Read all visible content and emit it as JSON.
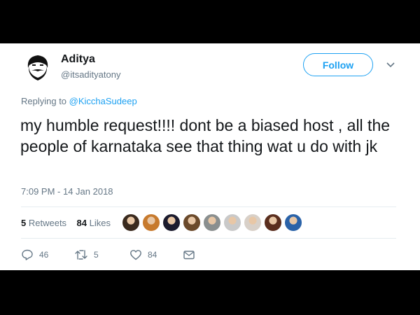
{
  "user": {
    "name": "Aditya",
    "handle": "@itsadityatony",
    "avatar_icon": "mustache-face-icon"
  },
  "follow_label": "Follow",
  "reply": {
    "prefix": "Replying to ",
    "mention": "@KicchaSudeep"
  },
  "tweet_text": "my humble request!!!! dont be a biased host , all the people of karnataka see that thing wat u do with jk",
  "timestamp": "7:09 PM - 14 Jan 2018",
  "stats": {
    "retweets_count": "5",
    "retweets_label": "Retweets",
    "likes_count": "84",
    "likes_label": "Likes"
  },
  "liker_avatars": [
    "#3a2a1e",
    "#c77a2d",
    "#1b1b2e",
    "#6b4a2b",
    "#8a8f8f",
    "#c9c9c9",
    "#d8d0c8",
    "#5a2e1e",
    "#2a62a8"
  ],
  "actions": {
    "reply_count": "46",
    "retweet_count": "5",
    "like_count": "84"
  },
  "colors": {
    "accent": "#1da1f2",
    "text": "#14171a",
    "muted": "#657786"
  }
}
